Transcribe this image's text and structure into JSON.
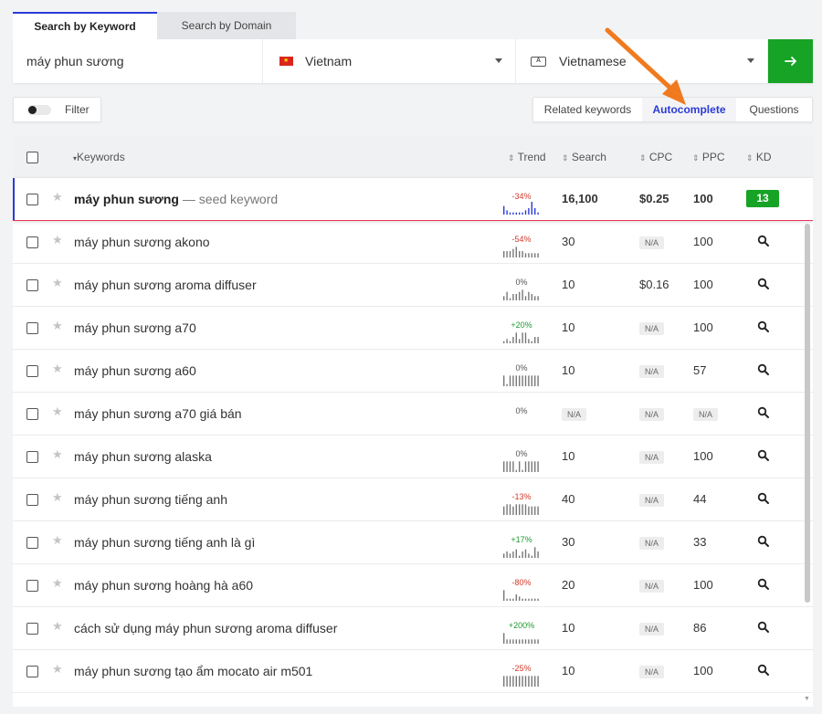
{
  "tabs": {
    "keyword": "Search by Keyword",
    "domain": "Search by Domain"
  },
  "search": {
    "value": "máy phun sương",
    "country": "Vietnam",
    "language": "Vietnamese",
    "go_icon": "arrow-right-icon"
  },
  "filter": {
    "label": "Filter"
  },
  "keyword_tabs": {
    "related": "Related keywords",
    "autocomplete": "Autocomplete",
    "questions": "Questions"
  },
  "table": {
    "headers": {
      "keywords": "Keywords",
      "trend": "Trend",
      "search": "Search",
      "cpc": "CPC",
      "ppc": "PPC",
      "kd": "KD"
    },
    "seed": {
      "keyword": "máy phun sương",
      "note": "— seed keyword",
      "trend": "-34%",
      "trend_bars": [
        4,
        2,
        1,
        1,
        1,
        1,
        1,
        2,
        3,
        6,
        3,
        1
      ],
      "search": "16,100",
      "cpc": "$0.25",
      "ppc": "100",
      "kd": "13"
    },
    "rows": [
      {
        "keyword": "máy phun sương akono",
        "trend": "-54%",
        "trend_bars": [
          3,
          3,
          3,
          4,
          5,
          3,
          3,
          2,
          2,
          2,
          2,
          2
        ],
        "search": "30",
        "cpc": "N/A",
        "ppc": "100"
      },
      {
        "keyword": "máy phun sương aroma diffuser",
        "trend": "0%",
        "trend_bars": [
          2,
          4,
          1,
          3,
          3,
          4,
          5,
          2,
          4,
          3,
          2,
          2
        ],
        "search": "10",
        "cpc": "$0.16",
        "ppc": "100"
      },
      {
        "keyword": "máy phun sương a70",
        "trend": "+20%",
        "trend_bars": [
          1,
          2,
          1,
          3,
          5,
          2,
          5,
          5,
          2,
          1,
          3,
          3
        ],
        "search": "10",
        "cpc": "N/A",
        "ppc": "100"
      },
      {
        "keyword": "máy phun sương a60",
        "trend": "0%",
        "trend_bars": [
          5,
          1,
          5,
          5,
          5,
          5,
          5,
          5,
          5,
          5,
          5,
          5
        ],
        "search": "10",
        "cpc": "N/A",
        "ppc": "57"
      },
      {
        "keyword": "máy phun sương a70 giá bán",
        "trend": "0%",
        "trend_bars": [],
        "search": "N/A",
        "cpc": "N/A",
        "ppc": "N/A"
      },
      {
        "keyword": "máy phun sương alaska",
        "trend": "0%",
        "trend_bars": [
          5,
          5,
          5,
          5,
          1,
          5,
          1,
          5,
          5,
          5,
          5,
          5
        ],
        "search": "10",
        "cpc": "N/A",
        "ppc": "100"
      },
      {
        "keyword": "máy phun sương tiếng anh",
        "trend": "-13%",
        "trend_bars": [
          4,
          5,
          5,
          4,
          5,
          5,
          5,
          5,
          4,
          4,
          4,
          4
        ],
        "search": "40",
        "cpc": "N/A",
        "ppc": "44"
      },
      {
        "keyword": "máy phun sương tiếng anh là gì",
        "trend": "+17%",
        "trend_bars": [
          2,
          3,
          2,
          3,
          4,
          1,
          3,
          4,
          2,
          1,
          5,
          3
        ],
        "search": "30",
        "cpc": "N/A",
        "ppc": "33"
      },
      {
        "keyword": "máy phun sương hoàng hà a60",
        "trend": "-80%",
        "trend_bars": [
          5,
          1,
          1,
          1,
          3,
          2,
          1,
          1,
          1,
          1,
          1,
          1
        ],
        "search": "20",
        "cpc": "N/A",
        "ppc": "100"
      },
      {
        "keyword": "cách sử dụng máy phun sương aroma diffuser",
        "trend": "+200%",
        "trend_bars": [
          5,
          2,
          2,
          2,
          2,
          2,
          2,
          2,
          2,
          2,
          2,
          2
        ],
        "search": "10",
        "cpc": "N/A",
        "ppc": "86"
      },
      {
        "keyword": "máy phun sương tạo ẩm mocato air m501",
        "trend": "-25%",
        "trend_bars": [
          5,
          5,
          5,
          5,
          5,
          5,
          5,
          5,
          5,
          5,
          5,
          5
        ],
        "search": "10",
        "cpc": "N/A",
        "ppc": "100"
      }
    ]
  },
  "colors": {
    "accent": "#2b3bd6",
    "go_green": "#17a325",
    "negative": "#d0392b",
    "positive": "#1e9b2c",
    "arrow": "#f07a1f"
  }
}
